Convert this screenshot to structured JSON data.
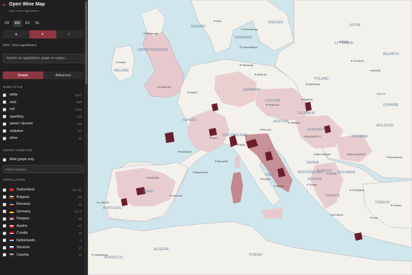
{
  "app": {
    "title": "Open Wine Map",
    "subtitle": "Map of wine appellations",
    "languages": [
      "FR",
      "EN",
      "ES",
      "NL"
    ],
    "active_language": "EN",
    "theme_icons": [
      "sun-icon",
      "half-moon-icon",
      "moon-icon"
    ],
    "theme_glyphs": [
      "☀",
      "◐",
      "☾"
    ],
    "appellation_count": "2341 / 2814 appellations",
    "search_placeholder": "Search an appellation, grape or region...",
    "modes": [
      "Simple",
      "Advanced"
    ],
    "active_mode": "Simple"
  },
  "wine_style": {
    "title": "WINE STYLE",
    "items": [
      {
        "label": "white",
        "count": "1627"
      },
      {
        "label": "rosé",
        "count": "898"
      },
      {
        "label": "red",
        "count": "1830"
      },
      {
        "label": "sparkling",
        "count": "419"
      },
      {
        "label": "sweet / dessert",
        "count": "138"
      },
      {
        "label": "oxidative",
        "count": "97"
      },
      {
        "label": "other",
        "count": "11"
      }
    ]
  },
  "grape_varieties": {
    "title": "GRAPE VARIETIES",
    "main_only": "Main grape only",
    "search_placeholder": "Search grapes..."
  },
  "appellation": {
    "title": "APPELLATION",
    "items": [
      {
        "label": "Switzerland",
        "count": "30 / 61"
      },
      {
        "label": "Bulgaria",
        "count": "52"
      },
      {
        "label": "Romania",
        "count": "34"
      },
      {
        "label": "Germany",
        "count": "13 / 0"
      },
      {
        "label": "Hungary",
        "count": "35"
      },
      {
        "label": "Austria",
        "count": "27"
      },
      {
        "label": "Croatia",
        "count": "18"
      },
      {
        "label": "Netherlands",
        "count": "4"
      },
      {
        "label": "Slovenia",
        "count": "14"
      },
      {
        "label": "Czechia",
        "count": "11"
      }
    ],
    "flags": [
      [
        "#d52b1e",
        "#d52b1e",
        "#d52b1e"
      ],
      [
        "#ffffff",
        "#00966e",
        "#d62612"
      ],
      [
        "#002b7f",
        "#fcd116",
        "#ce1126"
      ],
      [
        "#000000",
        "#dd0000",
        "#ffce00"
      ],
      [
        "#ce2939",
        "#ffffff",
        "#477050"
      ],
      [
        "#ed2939",
        "#ffffff",
        "#ed2939"
      ],
      [
        "#ff0000",
        "#ffffff",
        "#171796"
      ],
      [
        "#ae1c28",
        "#ffffff",
        "#21468b"
      ],
      [
        "#ffffff",
        "#005ce6",
        "#ff0000"
      ],
      [
        "#ffffff",
        "#d7141a",
        "#11457e"
      ]
    ]
  },
  "map": {
    "country_labels": [
      "IRELAND",
      "UNITED KINGDOM",
      "NORWAY",
      "DENMARK",
      "SWEDEN",
      "LATVIA",
      "LITHUANIA",
      "BELARUS",
      "POLAND",
      "GERMANY",
      "UKRAINE",
      "ROMANIA",
      "SERBIA",
      "MOLDOVA",
      "FRANCE",
      "ITALY",
      "SPAIN",
      "PORTUGAL",
      "GREECE",
      "TÜRKIYE",
      "ALGERIA",
      "TUNISIA",
      "MOROCCO",
      "BULGARIA",
      "ALBANIA",
      "KOSOVO",
      "MONTENEGRO",
      "HUNGARY",
      "CZECHIA",
      "AUSTRIA",
      "SLOVAKIA",
      "SWITZERLAND"
    ],
    "city_labels": [
      "Edinburgh",
      "Dublin",
      "LONDON",
      "Hamburg",
      "BERLIN",
      "WARSAW",
      "PRAGUE",
      "Kraków",
      "PARIS",
      "VIENNA",
      "Munich",
      "Milan",
      "ROME",
      "Barcelona",
      "MADRID",
      "Valencia",
      "Naples",
      "BUDAPEST",
      "BELGRADE",
      "BUCHAREST",
      "SOFIA",
      "ISTANBUL",
      "ATHENS",
      "LISBON",
      "Casablanca",
      "KYIV",
      "MINSK",
      "VILNIUS",
      "RIGA",
      "Copenhagen",
      "Gothenburg",
      "Oslo",
      "Marseille",
      "Lyon",
      "Bordeaux",
      "Sevastopol",
      "Ankara",
      "Izmir",
      "Tirana"
    ],
    "colors": {
      "sea": "#cfe6ec",
      "land": "#f3f1ec",
      "border": "#b4a9b7",
      "wine_light": "#e7c9cd",
      "wine_mid": "#c4868f",
      "wine_dark": "#6b1f2d"
    }
  }
}
